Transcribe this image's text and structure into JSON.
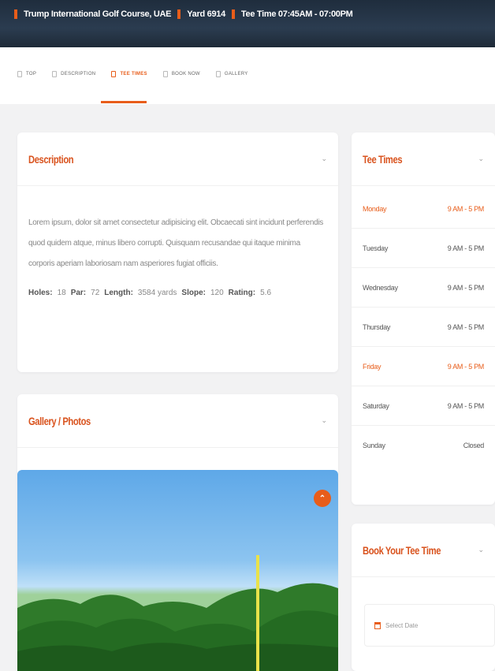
{
  "header": {
    "course": "Trump International Golf Course, UAE",
    "yards": "Yard 6914",
    "tee_time": "Tee Time 07:45AM - 07:00PM"
  },
  "tabs": [
    {
      "label": "TOP",
      "active": false
    },
    {
      "label": "DESCRIPTION",
      "active": false
    },
    {
      "label": "TEE TIMES",
      "active": true
    },
    {
      "label": "BOOK NOW",
      "active": false
    },
    {
      "label": "GALLERY",
      "active": false
    }
  ],
  "description": {
    "title": "Description",
    "text": "Lorem ipsum, dolor sit amet consectetur adipisicing elit. Obcaecati sint incidunt perferendis quod quidem atque, minus libero corrupti. Quisquam recusandae qui itaque minima corporis aperiam laboriosam nam asperiores fugiat officiis.",
    "stats": {
      "holes_label": "Holes:",
      "holes": "18",
      "par_label": "Par:",
      "par": "72",
      "length_label": "Length:",
      "length": "3584 yards",
      "slope_label": "Slope:",
      "slope": "120",
      "rating_label": "Rating:",
      "rating": "5.6"
    }
  },
  "gallery": {
    "title": "Gallery / Photos",
    "fab_icon": "chevron-up-icon"
  },
  "tee_times": {
    "title": "Tee Times",
    "rows": [
      {
        "day": "Monday",
        "hours": "9 AM - 5 PM",
        "highlight": true
      },
      {
        "day": "Tuesday",
        "hours": "9 AM - 5 PM",
        "highlight": false
      },
      {
        "day": "Wednesday",
        "hours": "9 AM - 5 PM",
        "highlight": false
      },
      {
        "day": "Thursday",
        "hours": "9 AM - 5 PM",
        "highlight": false
      },
      {
        "day": "Friday",
        "hours": "9 AM - 5 PM",
        "highlight": true
      },
      {
        "day": "Saturday",
        "hours": "9 AM - 5 PM",
        "highlight": false
      },
      {
        "day": "Sunday",
        "hours": "Closed",
        "highlight": false
      }
    ]
  },
  "booking": {
    "title": "Book Your Tee Time",
    "date_placeholder": "Select Date"
  },
  "colors": {
    "accent": "#e85d1a",
    "header_bg": "#1f2d3d"
  }
}
